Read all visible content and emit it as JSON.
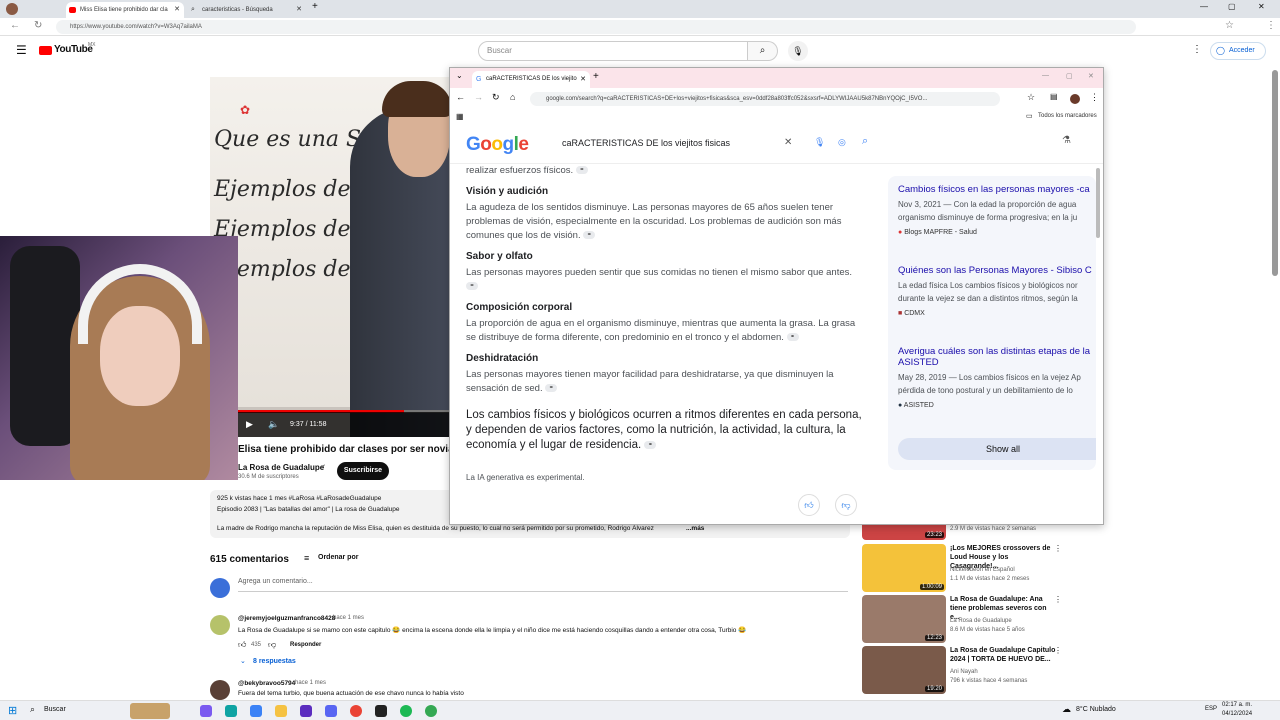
{
  "browser": {
    "tabs": [
      {
        "label": "Miss Elisa tiene prohibido dar cla"
      },
      {
        "label": "caracteristicas - Búsqueda"
      }
    ],
    "url": "https://www.youtube.com/watch?v=W3Aq7ailaMA"
  },
  "youtube": {
    "logo": "YouTube",
    "logo_region": "MX",
    "search_placeholder": "Buscar",
    "login": "Acceder",
    "video_time": "9:37 / 11:58",
    "video_progress": 0.81,
    "board_lines": [
      "Que es una Silaba",
      "Ejemplos de Silaba",
      "Ejemplos de S",
      "Ejemplos de"
    ],
    "title": "Elisa tiene prohibido dar clases por ser novia de",
    "channel": "La Rosa de Guadalupe",
    "subscribers": "30.6 M de suscriptores",
    "subscribe": "Suscribirse",
    "stats": "925 k vistas  hace 1 mes  #LaRosa #LaRosadeGuadalupe",
    "episode": "Episodio 2083 | \"Las batallas del amor\" | La rosa de Guadalupe",
    "description": "La madre de Rodrigo mancha la reputación de Miss Elisa, quien es destituida de su puesto, lo cual no será permitido por su prometido, Rodrigo Álvarez",
    "more": "...más",
    "comments_count": "615 comentarios",
    "sort": "Ordenar por",
    "add_comment": "Agrega un comentario...",
    "comments": [
      {
        "user": "@jeremyjoelguzmanfranco8428",
        "time": "hace 1 mes",
        "text": "La Rosa de Guadalupe si se mamo con este capitulo 😂 encima la escena donde ella le limpia y el niño dice me está haciendo cosquillas dando a entender otra cosa, Turbio 😂",
        "likes": "435",
        "reply": "Responder",
        "replies": "8 respuestas"
      },
      {
        "user": "@bekybravoo5794",
        "time": "hace 1 mes",
        "text": "Fuera del tema turbio, que buena actuación de ese chavo nunca lo había visto"
      }
    ],
    "related": [
      {
        "title": "",
        "channel": "",
        "meta": "2.9 M de vistas  hace 2 semanas",
        "duration": "23:23",
        "color": "#d33"
      },
      {
        "title": "¡Los MEJORES crossovers de Loud House y los Casagrande!...",
        "channel": "Nickelodeon en Español",
        "meta": "1.1 M de vistas  hace 2 meses",
        "duration": "1:00:09",
        "color": "#f4c23a"
      },
      {
        "title": "La Rosa de Guadalupe: Ana tiene problemas severos con e...",
        "channel": "La Rosa de Guadalupe",
        "meta": "8.6 M de vistas  hace 5 años",
        "duration": "12:23",
        "color": "#9a7a6a"
      },
      {
        "title": "La Rosa de Guadalupe Capitulo 2024 | TORTA DE HUEVO DE...",
        "channel": "Ani Nayah",
        "meta": "796 k vistas  hace 4 semanas",
        "duration": "19:20",
        "color": "#7a5a4a"
      }
    ]
  },
  "chrome2": {
    "tab_label": "caRACTERISTICAS DE los viejito",
    "url": "google.com/search?q=caRACTERISTICAS+DE+los+viejitos+fisicas&sca_esv=0ddf28a803ffc052&sxsrf=ADLYWIJAAU5k87NBnYQOjC_I5VO...",
    "bookmarks": "Todos los marcadores",
    "query": "caRACTERISTICAS DE los viejitos fisicas",
    "top_fragment": "realizar esfuerzos físicos.",
    "sections": [
      {
        "heading": "Visión y audición",
        "text": "La agudeza de los sentidos disminuye. Las personas mayores de 65 años suelen tener problemas de visión, especialmente en la oscuridad. Los problemas de audición son más comunes que los de visión."
      },
      {
        "heading": "Sabor y olfato",
        "text": "Las personas mayores pueden sentir que sus comidas no tienen el mismo sabor que antes."
      },
      {
        "heading": "Composición corporal",
        "text": "La proporción de agua en el organismo disminuye, mientras que aumenta la grasa. La grasa se distribuye de forma diferente, con predominio en el tronco y el abdomen."
      },
      {
        "heading": "Deshidratación",
        "text": "Las personas mayores tienen mayor facilidad para deshidratarse, ya que disminuyen la sensación de sed."
      }
    ],
    "summary": "Los cambios físicos y biológicos ocurren a ritmos diferentes en cada persona, y dependen de varios factores, como la nutrición, la actividad, la cultura, la economía y el lugar de residencia.",
    "experimental": "La IA generativa es experimental.",
    "sources": [
      {
        "title": "Cambios físicos en las personas mayores -ca",
        "snippet1": "Nov 3, 2021 — Con la edad la proporción de agua",
        "snippet2": "organismo disminuye de forma progresiva; en la ju",
        "source": "Blogs MAPFRE - Salud"
      },
      {
        "title": "Quiénes son las Personas Mayores - Sibiso C",
        "snippet1": "La edad física Los cambios físicos y biológicos nor",
        "snippet2": "durante la vejez se dan a distintos ritmos, según la",
        "source": "CDMX"
      },
      {
        "title": "Averigua cuáles son las distintas etapas de la",
        "title2": "ASISTED",
        "snippet1": "May 28, 2019 — Los cambios físicos en la vejez Ap",
        "snippet2": "pérdida de tono postural y un debilitamiento de lo",
        "source": "ASISTED"
      }
    ],
    "show_all": "Show all"
  },
  "taskbar": {
    "search": "Buscar",
    "weather": "8°C  Nublado",
    "lang": "ESP",
    "time": "02:17 a. m.",
    "date": "04/12/2024"
  }
}
